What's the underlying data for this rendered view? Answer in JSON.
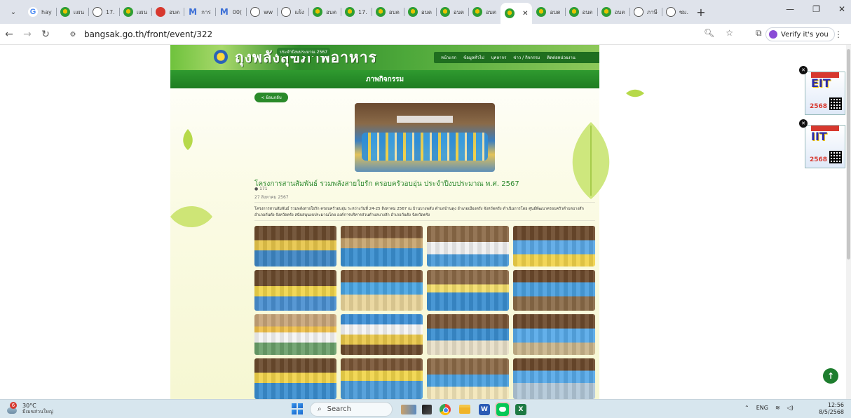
{
  "browser": {
    "tabs": [
      {
        "label": "hay",
        "icon": "google-icon"
      },
      {
        "label": "แผน",
        "icon": "emblem-icon"
      },
      {
        "label": "17.",
        "icon": "globe-icon"
      },
      {
        "label": "แผน",
        "icon": "emblem-icon"
      },
      {
        "label": "อบต",
        "icon": "red-emblem-icon"
      },
      {
        "label": "การ",
        "icon": "m-icon"
      },
      {
        "label": "00(",
        "icon": "m-icon"
      },
      {
        "label": "ww",
        "icon": "globe-icon"
      },
      {
        "label": "แผ้ง",
        "icon": "globe-icon"
      },
      {
        "label": "อบต",
        "icon": "emblem-icon"
      },
      {
        "label": "17.",
        "icon": "emblem-icon"
      },
      {
        "label": "อบต",
        "icon": "emblem-icon"
      },
      {
        "label": "อบต",
        "icon": "emblem-icon"
      },
      {
        "label": "อบต",
        "icon": "emblem-icon"
      },
      {
        "label": "อบต",
        "icon": "emblem-icon"
      },
      {
        "label": "",
        "icon": "emblem-icon",
        "active": true
      },
      {
        "label": "อบต",
        "icon": "emblem-icon"
      },
      {
        "label": "อบต",
        "icon": "emblem-icon"
      },
      {
        "label": "อบต",
        "icon": "emblem-icon"
      },
      {
        "label": "ภาษี",
        "icon": "globe-icon"
      },
      {
        "label": "ชม.",
        "icon": "globe-icon"
      }
    ],
    "url": "bangsak.go.th/front/event/322",
    "verify_label": "Verify it's you"
  },
  "site": {
    "banner_title": "ถุงพลังสุขภาพอาหาร",
    "banner_subtitle": "ประจำปีงบประมาณ 2567",
    "nav": [
      "หน้าแรก",
      "ข้อมูลทั่วไป",
      "บุคลากร",
      "ข่าว / กิจกรรม",
      "ติดต่อหน่วยงาน"
    ],
    "section_title": "ภาพกิจกรรม",
    "back_label": "< ย้อนกลับ",
    "post": {
      "title": "โครงการสานสัมพันธ์ รวมพลังสายใยรัก ครอบครัวอบอุ่น ประจำปีงบประมาณ พ.ศ. 2567",
      "views": "171",
      "date": "27 สิงหาคม 2567",
      "description": "โครงการสานสัมพันธ์ รวมพลังสายใยรัก ครอบครัวอบอุ่น ระหว่างวันที่ 24-25 สิงหาคม 2567 ณ บ้านบางพลับ ตำบลบ้านดุง อำเภอเมืองตรัง จังหวัดตรัง ดำเนินการโดย ศูนย์พัฒนาครอบครัวตำบลบางสัก อำเภอกันตัง จังหวัดตรัง สนับสนุนงบประมาณโดย องค์การบริหารส่วนตำบลบางสัก อำเภอกันตัง จังหวัดตรัง"
    },
    "gallery_count": 16
  },
  "ads": [
    {
      "headline": "EIT",
      "year": "2568"
    },
    {
      "headline": "IIT",
      "year": "2568"
    }
  ],
  "taskbar": {
    "weather_temp": "30°C",
    "weather_cond": "มีเมฆส่วนใหญ่",
    "weather_badge": "6",
    "search_label": "Search",
    "lang": "ENG",
    "time": "12:56",
    "date": "8/5/2568"
  }
}
